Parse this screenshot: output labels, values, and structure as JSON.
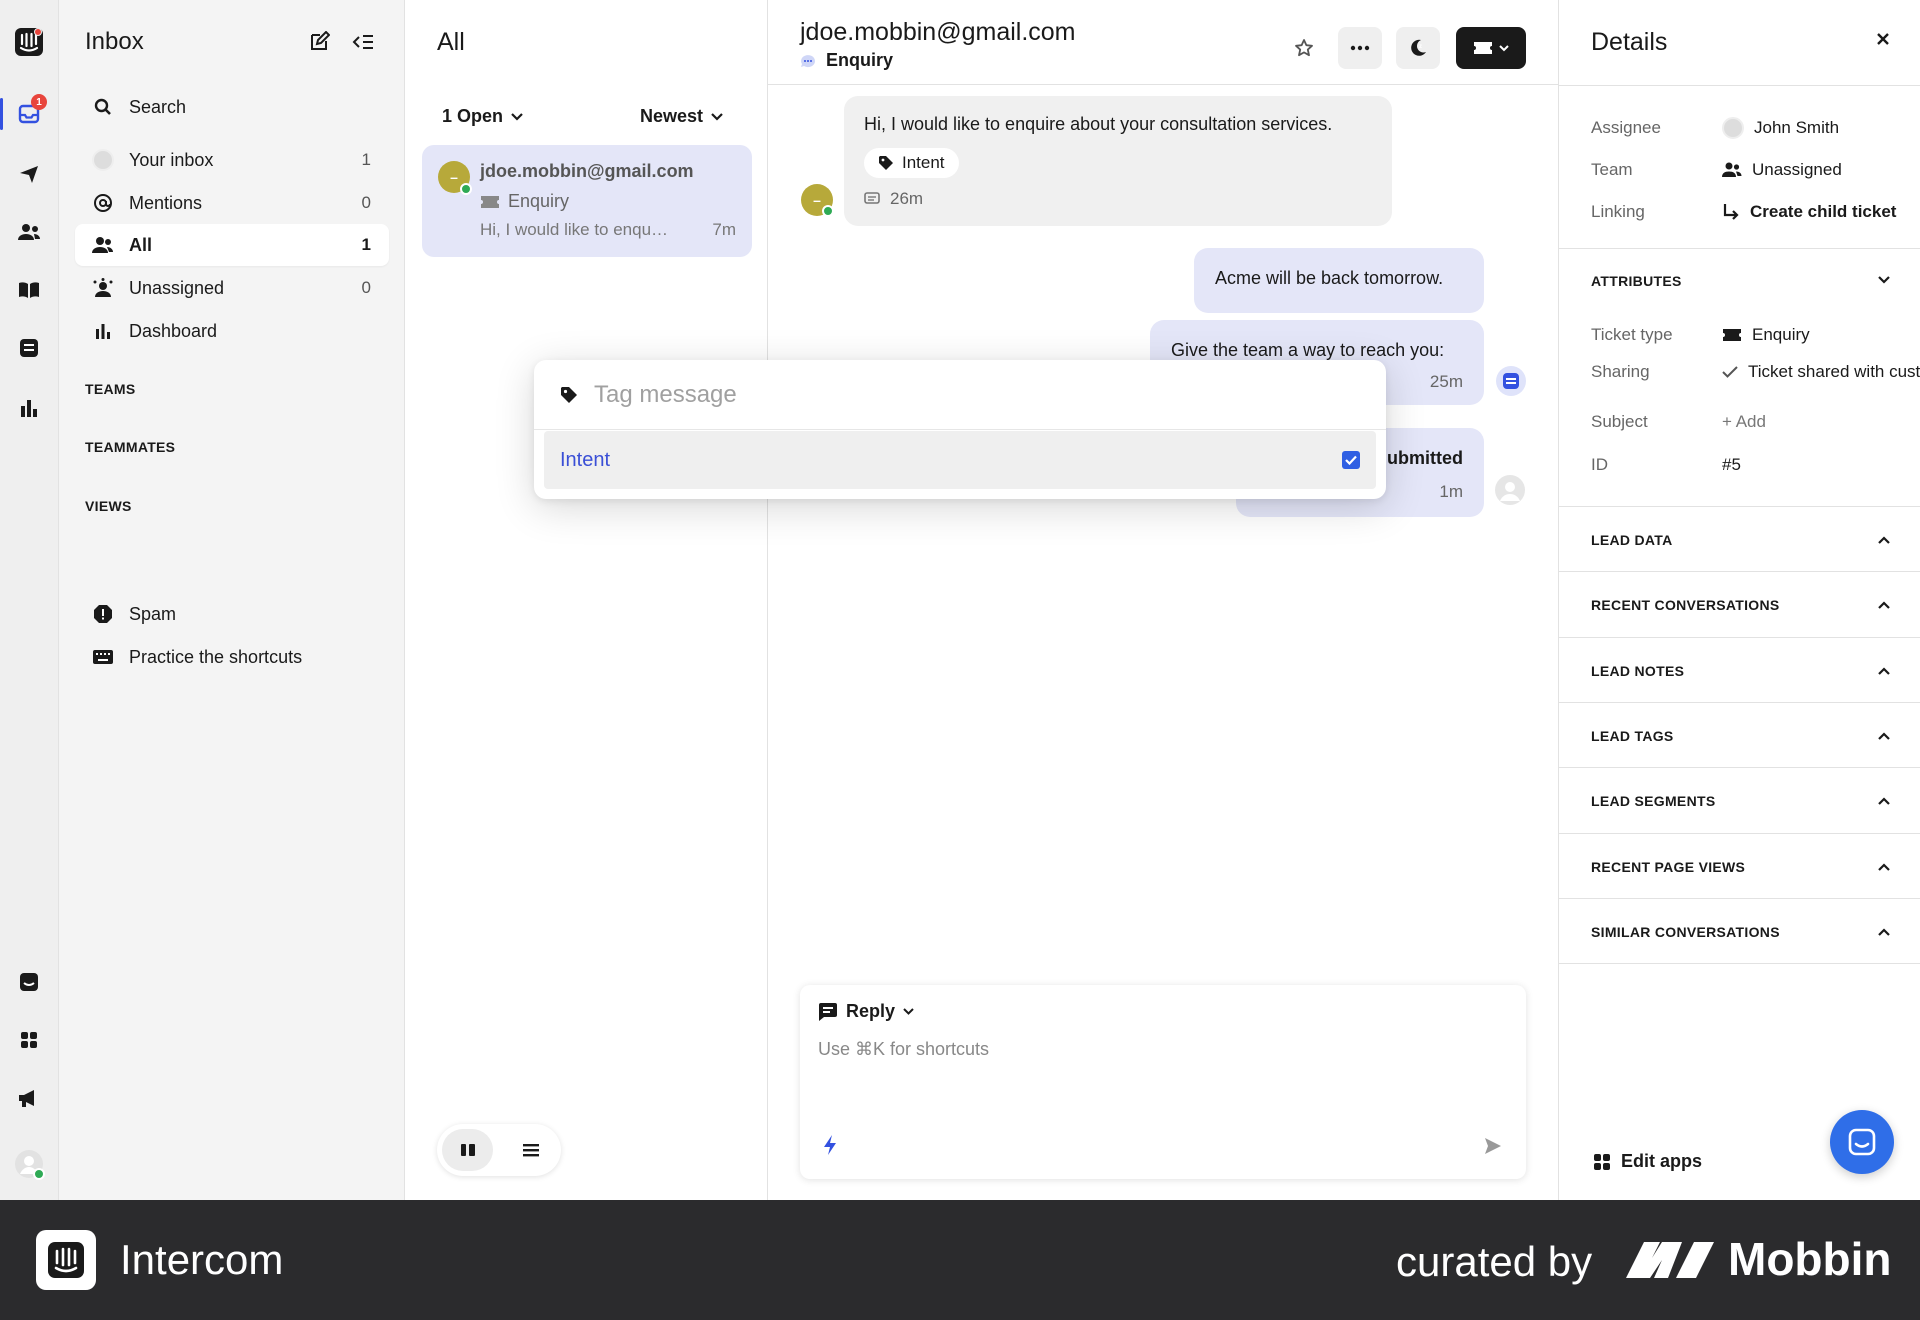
{
  "rail": {
    "inbox_badge": "1",
    "icons": [
      "app-logo-icon",
      "inbox-icon",
      "outbound-icon",
      "contacts-icon",
      "knowledge-icon",
      "conversations-icon",
      "reports-icon",
      "messenger-icon",
      "apps-icon",
      "announcements-icon",
      "user-avatar"
    ]
  },
  "nav": {
    "title": "Inbox",
    "search_label": "Search",
    "items": [
      {
        "label": "Your inbox",
        "count": "1"
      },
      {
        "label": "Mentions",
        "count": "0"
      },
      {
        "label": "All",
        "count": "1"
      },
      {
        "label": "Unassigned",
        "count": "0"
      },
      {
        "label": "Dashboard",
        "count": ""
      }
    ],
    "sections": {
      "teams": "TEAMS",
      "teammates": "TEAMMATES",
      "views": "VIEWS"
    },
    "bottom_items": [
      {
        "label": "Spam"
      },
      {
        "label": "Practice the shortcuts"
      }
    ]
  },
  "list": {
    "title": "All",
    "status_filter": "1 Open",
    "sort_filter": "Newest",
    "conversations": [
      {
        "email": "jdoe.mobbin@gmail.com",
        "type": "Enquiry",
        "preview": "Hi, I would like to enquire about your consultation services.",
        "time": "7m",
        "avatar": "–"
      }
    ]
  },
  "conversation": {
    "email": "jdoe.mobbin@gmail.com",
    "type": "Enquiry",
    "messages": [
      {
        "text": "Hi, I would like to enquire about your consultation services.",
        "tag": "Intent",
        "time": "26m"
      },
      {
        "text": "Acme will be back tomorrow."
      },
      {
        "text": "Give the team a way to reach you:",
        "time": "25m"
      },
      {
        "text": "ubmitted",
        "time": "1m"
      }
    ],
    "composer": {
      "mode": "Reply",
      "placeholder": "Use ⌘K for shortcuts"
    }
  },
  "tag_popover": {
    "placeholder": "Tag message",
    "options": [
      {
        "label": "Intent",
        "checked": true
      }
    ]
  },
  "details": {
    "title": "Details",
    "rows": [
      {
        "key": "Assignee",
        "value": "John Smith"
      },
      {
        "key": "Team",
        "value": "Unassigned"
      },
      {
        "key": "Linking",
        "value": "Create child ticket"
      }
    ],
    "attributes_title": "ATTRIBUTES",
    "attributes": [
      {
        "key": "Ticket type",
        "value": "Enquiry"
      },
      {
        "key": "Sharing",
        "value": "Ticket shared with customer"
      },
      {
        "key": "Subject",
        "value": "+ Add"
      },
      {
        "key": "ID",
        "value": "#5"
      }
    ],
    "sections": [
      "LEAD DATA",
      "RECENT CONVERSATIONS",
      "LEAD NOTES",
      "LEAD TAGS",
      "LEAD SEGMENTS",
      "RECENT PAGE VIEWS",
      "SIMILAR CONVERSATIONS"
    ],
    "edit_apps": "Edit apps"
  },
  "footer": {
    "brand": "Intercom",
    "curated_by": "curated by",
    "mobbin": "Mobbin"
  },
  "colors": {
    "accent": "#3351e0",
    "selection": "#e4e6f8",
    "badge": "#e8453c",
    "online": "#2faa55",
    "footer": "#2b2b2d"
  }
}
